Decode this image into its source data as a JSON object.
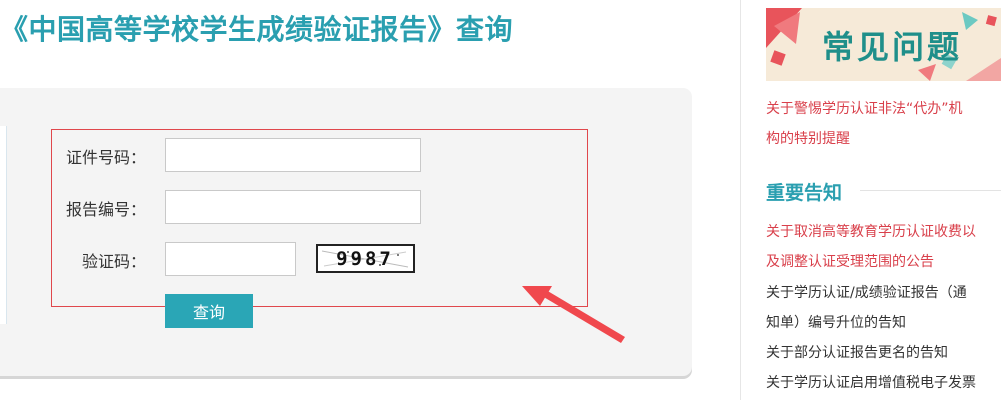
{
  "page": {
    "title": "《中国高等学校学生成绩验证报告》查询"
  },
  "form": {
    "cert_label": "证件号码：",
    "cert_value": "",
    "report_label": "报告编号：",
    "report_value": "",
    "captcha_label": "验证码：",
    "captcha_value": "",
    "captcha_image_text": "9987",
    "submit_label": "查询"
  },
  "sidebar": {
    "faq_banner": "常见问题",
    "faq_link": {
      "line1": "关于警惕学历认证非法“代办”机",
      "line2": "构的特别提醒"
    },
    "notice_heading": "重要告知",
    "notices": [
      {
        "line1": "关于取消高等教育学历认证收费以",
        "line2": "及调整认证受理范围的公告"
      },
      {
        "line1": "关于学历认证/成绩验证报告（通",
        "line2": "知单）编号升位的告知"
      },
      {
        "line1": "关于部分认证报告更名的告知"
      },
      {
        "line1": "关于学历认证启用增值税电子发票"
      }
    ]
  },
  "colors": {
    "accent": "#2a9fb0",
    "button": "#2aa6b6",
    "highlight_red": "#e0474c",
    "link_red": "#d9404b"
  }
}
